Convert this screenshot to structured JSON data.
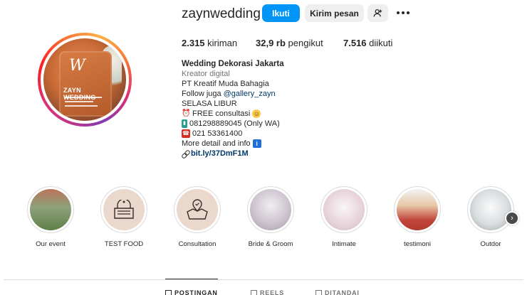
{
  "profile": {
    "username": "zaynwedding",
    "avatar_texts": {
      "logo": "W",
      "sign_text": "ZAYN WEDDING"
    }
  },
  "actions": {
    "follow_label": "Ikuti",
    "message_label": "Kirim pesan",
    "add_user_icon": "person-add-icon",
    "more_icon": "ellipsis-icon"
  },
  "stats": [
    {
      "value": "2.315",
      "label": "kiriman"
    },
    {
      "value": "32,9 rb",
      "label": "pengikut"
    },
    {
      "value": "7.516",
      "label": "diikuti"
    }
  ],
  "bio": {
    "name": "Wedding Dekorasi Jakarta",
    "category": "Kreator digital",
    "line1": "PT Kreatif Muda Bahagia",
    "follow_prefix": "Follow juga ",
    "follow_mention": "@gallery_zayn",
    "line3": "SELASA LIBUR",
    "line4": "FREE consultasi",
    "line5": "081298889045 (Only WA)",
    "line6": "021 53361400",
    "line7": "More detail and info",
    "link": "bit.ly/37DmF1M"
  },
  "highlights": [
    {
      "label": "Our event"
    },
    {
      "label": "TEST FOOD"
    },
    {
      "label": "Consultation"
    },
    {
      "label": "Bride & Groom"
    },
    {
      "label": "Intimate"
    },
    {
      "label": "testimoni"
    },
    {
      "label": "Outdor"
    }
  ],
  "tabs": [
    {
      "label": "POSTINGAN",
      "active": true
    },
    {
      "label": "REELS",
      "active": false
    },
    {
      "label": "DITANDAI",
      "active": false
    }
  ],
  "colors": {
    "accent": "#0095f6",
    "text": "#262626",
    "muted": "#737373",
    "link": "#00376b"
  }
}
